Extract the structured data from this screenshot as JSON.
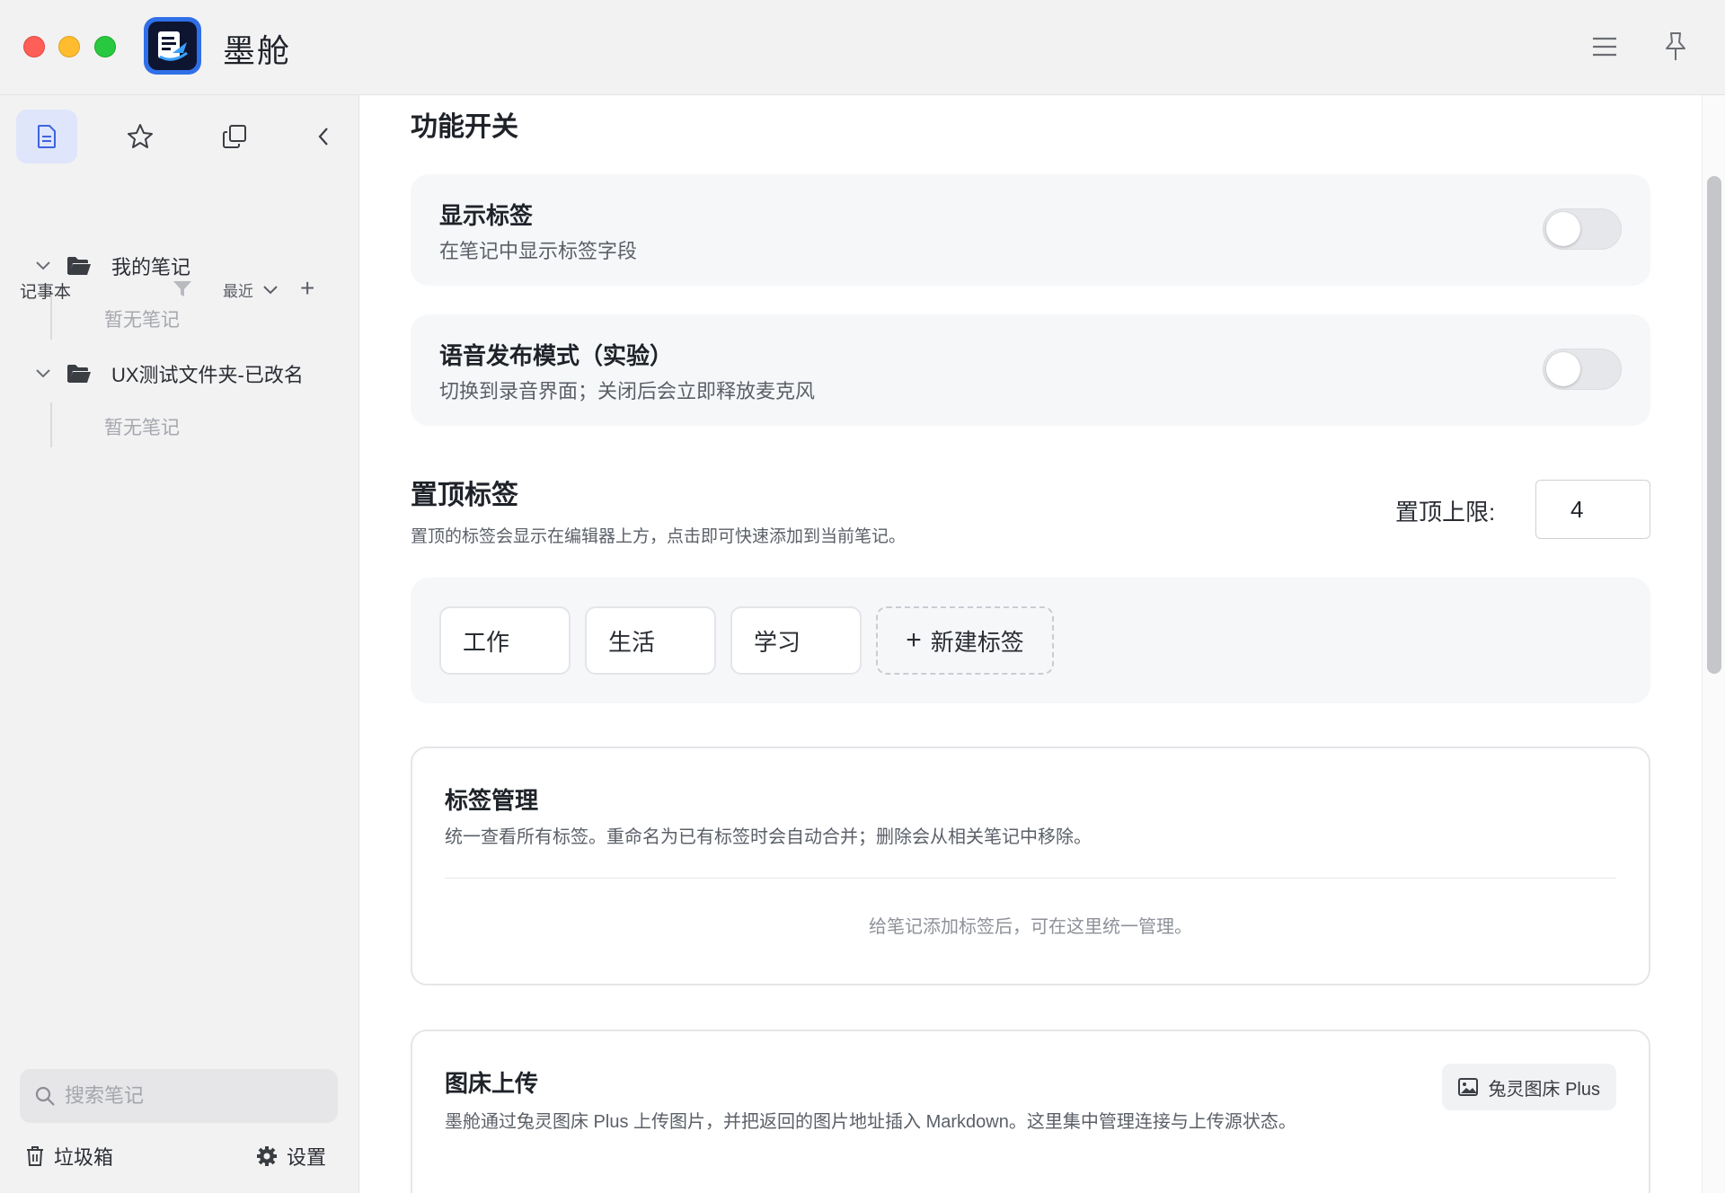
{
  "app": {
    "title": "墨舱"
  },
  "sidebar": {
    "notebook_title": "记事本",
    "sort_label": "最近",
    "folders": [
      {
        "name": "我的笔记",
        "empty_text": "暂无笔记"
      },
      {
        "name": "UX测试文件夹-已改名",
        "empty_text": "暂无笔记"
      }
    ],
    "search_placeholder": "搜索笔记",
    "trash_label": "垃圾箱",
    "settings_label": "设置"
  },
  "main": {
    "features_heading": "功能开关",
    "features": [
      {
        "title": "显示标签",
        "desc": "在笔记中显示标签字段",
        "enabled": false
      },
      {
        "title": "语音发布模式（实验）",
        "desc": "切换到录音界面；关闭后会立即释放麦克风",
        "enabled": false
      }
    ],
    "pinned": {
      "heading": "置顶标签",
      "desc": "置顶的标签会显示在编辑器上方，点击即可快速添加到当前笔记。",
      "limit_label": "置顶上限:",
      "limit_value": "4",
      "tags": [
        "工作",
        "生活",
        "学习"
      ],
      "new_tag_label": "新建标签"
    },
    "tag_management": {
      "title": "标签管理",
      "desc": "统一查看所有标签。重命名为已有标签时会自动合并；删除会从相关笔记中移除。",
      "empty_text": "给笔记添加标签后，可在这里统一管理。"
    },
    "image_upload": {
      "title": "图床上传",
      "desc": "墨舱通过兔灵图床 Plus 上传图片，并把返回的图片地址插入 Markdown。这里集中管理连接与上传源状态。",
      "provider_label": "兔灵图床 Plus"
    }
  }
}
